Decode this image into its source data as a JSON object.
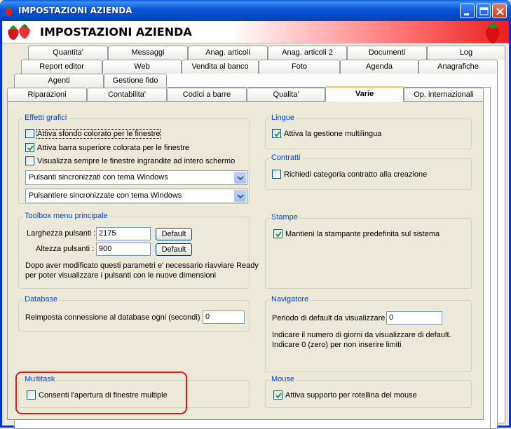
{
  "window": {
    "title": "IMPOSTAZIONI AZIENDA",
    "banner_title": "IMPOSTAZIONI AZIENDA"
  },
  "tabs": {
    "row1": [
      "Quantita'",
      "Messaggi",
      "Anag. articoli",
      "Anag. articoli 2",
      "Documenti",
      "Log"
    ],
    "row2": [
      "Report editor",
      "Web",
      "Vendita al banco",
      "Foto",
      "Agenda",
      "Anagrafiche"
    ],
    "row3": [
      "Agenti",
      "Gestione fido"
    ],
    "row4": [
      "Riparazioni",
      "Contabilita'",
      "Codici a barre",
      "Qualita'",
      "Varie",
      "Op. internazionali"
    ],
    "active": "Varie"
  },
  "effetti": {
    "legend": "Effetti grafici",
    "opt1": "Attiva sfondo colorato per le finestre",
    "opt1_checked": false,
    "opt2": "Attiva barra superiore colorata per le finestre",
    "opt2_checked": true,
    "opt3": "Visualizza sempre le finestre ingrandite ad intero schermo",
    "opt3_checked": false,
    "combo1": "Pulsanti sincronizzati con tema Windows",
    "combo2": "Pulsantiere sincronizzate con tema Windows"
  },
  "toolbox": {
    "legend": "Toolbox menu principale",
    "width_label": "Larghezza pulsanti :",
    "width_value": "2175",
    "height_label": "Altezza pulsanti :",
    "height_value": "900",
    "default_label": "Default",
    "note_line1": "Dopo aver modificato questi parametri e' necessario riavviare Ready",
    "note_line2": "per poter visualizzare i pulsanti con le nuove dimensioni"
  },
  "database": {
    "legend": "Database",
    "label": "Reimposta connessione al database ogni (secondi) :",
    "value": "0"
  },
  "multitask": {
    "legend": "Multitask",
    "opt": "Consenti l'apertura di finestre multiple",
    "checked": false
  },
  "lingue": {
    "legend": "Lingue",
    "opt": "Attiva la gestione multilingua",
    "checked": true
  },
  "contratti": {
    "legend": "Contratti",
    "opt": "Richiedi categoria contratto alla creazione",
    "checked": false
  },
  "stampe": {
    "legend": "Stampe",
    "opt": "Mantieni la stampante predefinita sul sistema",
    "checked": true
  },
  "navigatore": {
    "legend": "Navigatore",
    "label": "Periodo di default da visualizzare :",
    "value": "0",
    "note_line1": "Indicare il numero di giorni da visualizzare di default.",
    "note_line2": "Indicare 0 (zero) per non inserire limiti"
  },
  "mouse": {
    "legend": "Mouse",
    "opt": "Attiva supporto per rotellina del mouse",
    "checked": true
  },
  "colors": {
    "titlebar": "#0a54d6",
    "legend": "#0046d5",
    "highlight": "#e01818"
  }
}
